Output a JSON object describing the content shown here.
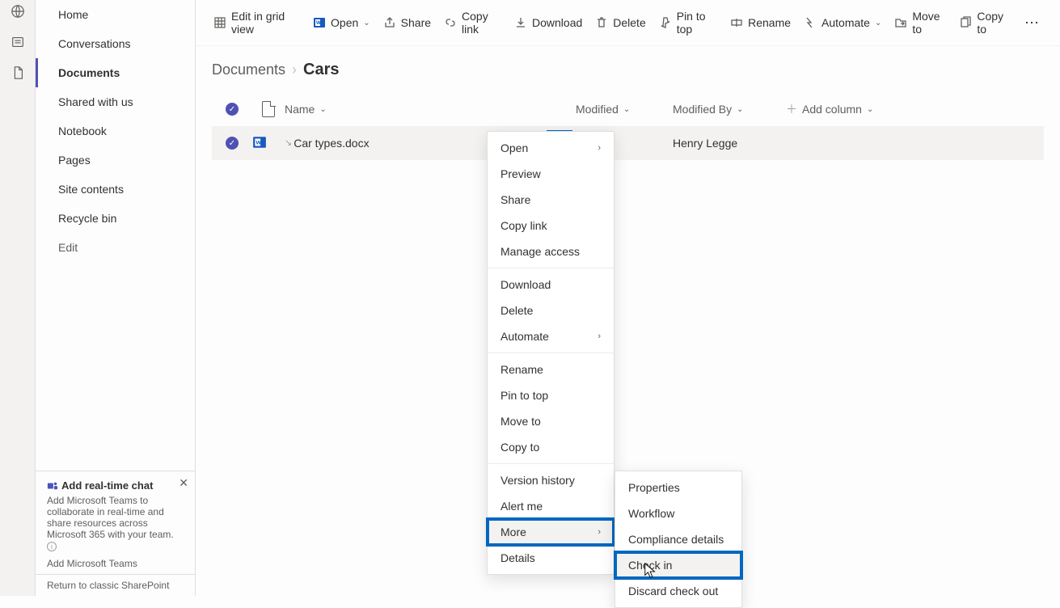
{
  "sidebar": {
    "items": [
      {
        "label": "Home"
      },
      {
        "label": "Conversations"
      },
      {
        "label": "Documents",
        "selected": true
      },
      {
        "label": "Shared with us"
      },
      {
        "label": "Notebook"
      },
      {
        "label": "Pages"
      },
      {
        "label": "Site contents"
      },
      {
        "label": "Recycle bin"
      }
    ],
    "edit_label": "Edit"
  },
  "promo": {
    "title": "Add real-time chat",
    "body": "Add Microsoft Teams to collaborate in real-time and share resources across Microsoft 365 with your team.",
    "link": "Add Microsoft Teams"
  },
  "return_link": "Return to classic SharePoint",
  "commandbar": {
    "edit_grid": "Edit in grid view",
    "open": "Open",
    "share": "Share",
    "copy_link": "Copy link",
    "download": "Download",
    "delete": "Delete",
    "pin": "Pin to top",
    "rename": "Rename",
    "automate": "Automate",
    "move": "Move to",
    "copy": "Copy to"
  },
  "breadcrumb": {
    "parent": "Documents",
    "current": "Cars"
  },
  "columns": {
    "name": "Name",
    "modified": "Modified",
    "modified_by": "Modified By",
    "add": "Add column"
  },
  "row": {
    "filename": "Car types.docx",
    "modified_by": "Henry Legge"
  },
  "ctx": {
    "open": "Open",
    "preview": "Preview",
    "share": "Share",
    "copy_link": "Copy link",
    "manage_access": "Manage access",
    "download": "Download",
    "delete": "Delete",
    "automate": "Automate",
    "rename": "Rename",
    "pin": "Pin to top",
    "move": "Move to",
    "copy": "Copy to",
    "version": "Version history",
    "alert": "Alert me",
    "more": "More",
    "details": "Details"
  },
  "sub": {
    "properties": "Properties",
    "workflow": "Workflow",
    "compliance": "Compliance details",
    "checkin": "Check in",
    "discard": "Discard check out"
  }
}
